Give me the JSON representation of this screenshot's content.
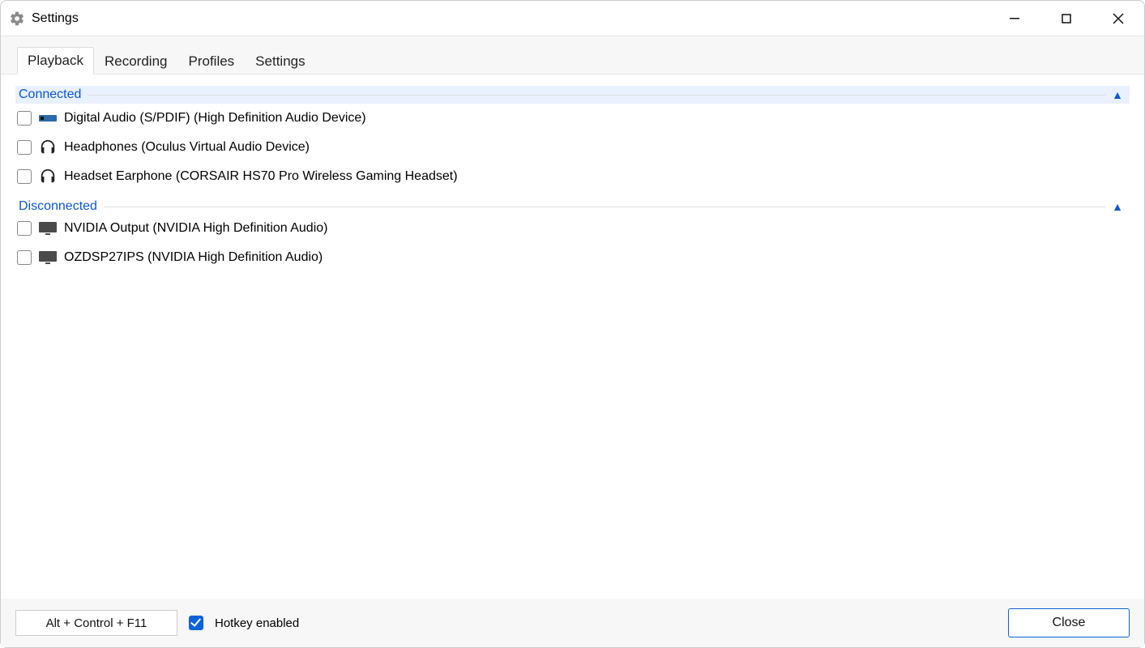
{
  "window": {
    "title": "Settings"
  },
  "tabs": [
    {
      "label": "Playback",
      "active": true
    },
    {
      "label": "Recording",
      "active": false
    },
    {
      "label": "Profiles",
      "active": false
    },
    {
      "label": "Settings",
      "active": false
    }
  ],
  "groups": {
    "connected": {
      "label": "Connected",
      "devices": [
        {
          "icon": "spdif",
          "label": "Digital Audio (S/PDIF) (High Definition Audio Device)",
          "checked": false
        },
        {
          "icon": "headphones",
          "label": "Headphones (Oculus Virtual Audio Device)",
          "checked": false
        },
        {
          "icon": "headphones",
          "label": "Headset Earphone (CORSAIR HS70 Pro Wireless Gaming Headset)",
          "checked": false
        }
      ]
    },
    "disconnected": {
      "label": "Disconnected",
      "devices": [
        {
          "icon": "monitor",
          "label": "NVIDIA Output (NVIDIA High Definition Audio)",
          "checked": false
        },
        {
          "icon": "monitor",
          "label": "OZDSP27IPS (NVIDIA High Definition Audio)",
          "checked": false
        }
      ]
    }
  },
  "footer": {
    "hotkey": "Alt + Control + F11",
    "hotkey_enabled_label": "Hotkey enabled",
    "hotkey_enabled": true,
    "close_label": "Close"
  }
}
